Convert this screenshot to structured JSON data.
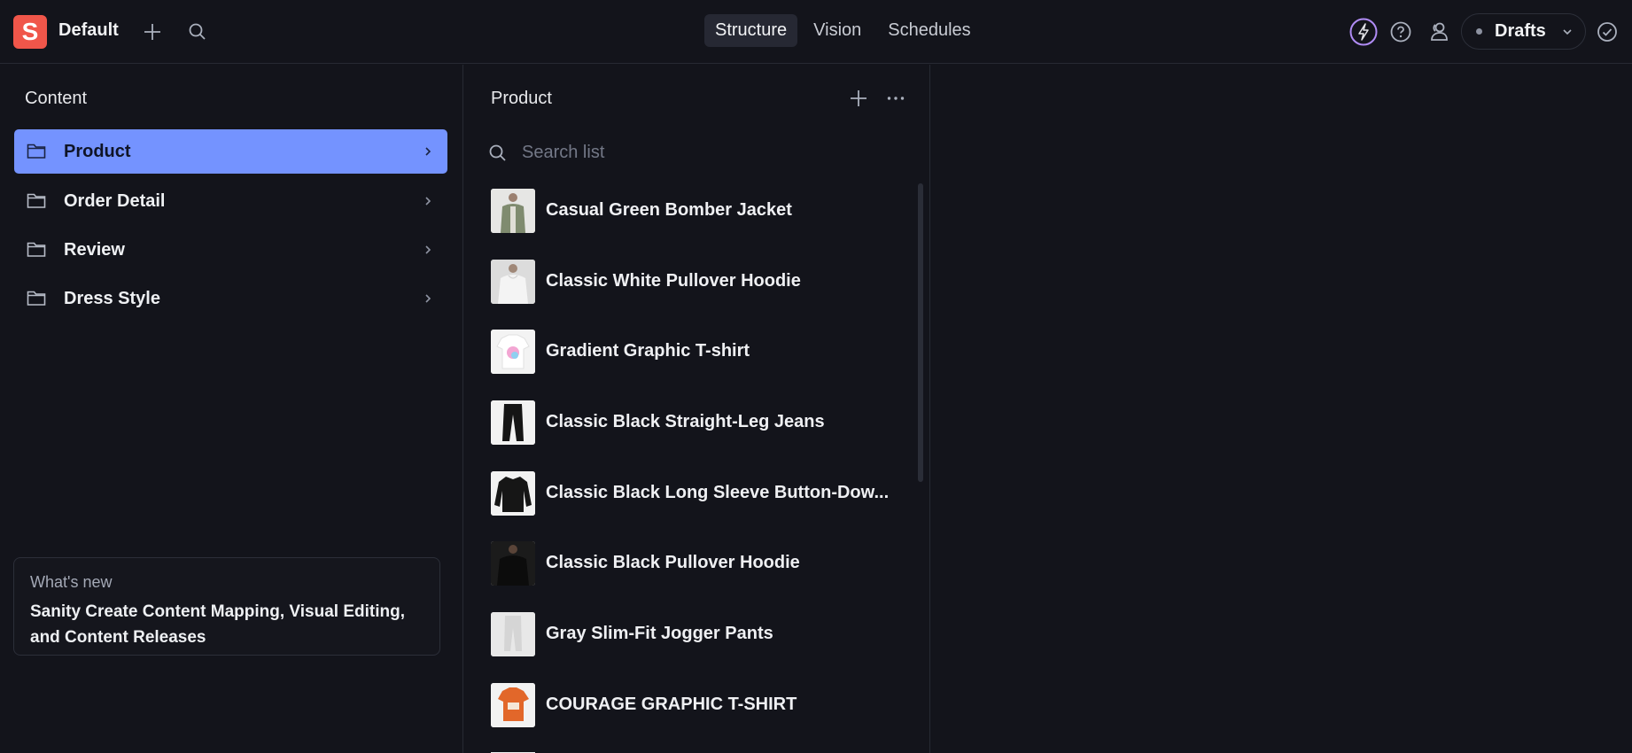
{
  "topbar": {
    "logo_letter": "S",
    "workspace": "Default",
    "tabs": [
      {
        "label": "Structure"
      },
      {
        "label": "Vision"
      },
      {
        "label": "Schedules"
      }
    ],
    "perspective": "Drafts",
    "accent": "#f0564a",
    "highlight": "#7493ff"
  },
  "sidebar": {
    "title": "Content",
    "items": [
      {
        "label": "Product"
      },
      {
        "label": "Order Detail"
      },
      {
        "label": "Review"
      },
      {
        "label": "Dress Style"
      }
    ],
    "whats_new": {
      "eyebrow": "What's new",
      "body": "Sanity Create Content Mapping, Visual Editing, and Content Releases"
    }
  },
  "list": {
    "title": "Product",
    "search_placeholder": "Search list",
    "items": [
      {
        "name": "Casual Green Bomber Jacket"
      },
      {
        "name": "Classic White Pullover Hoodie"
      },
      {
        "name": "Gradient Graphic T-shirt"
      },
      {
        "name": "Classic Black Straight-Leg Jeans"
      },
      {
        "name": "Classic Black Long Sleeve Button-Dow..."
      },
      {
        "name": "Classic Black Pullover Hoodie"
      },
      {
        "name": "Gray Slim-Fit Jogger Pants"
      },
      {
        "name": "COURAGE GRAPHIC T-SHIRT"
      }
    ]
  }
}
